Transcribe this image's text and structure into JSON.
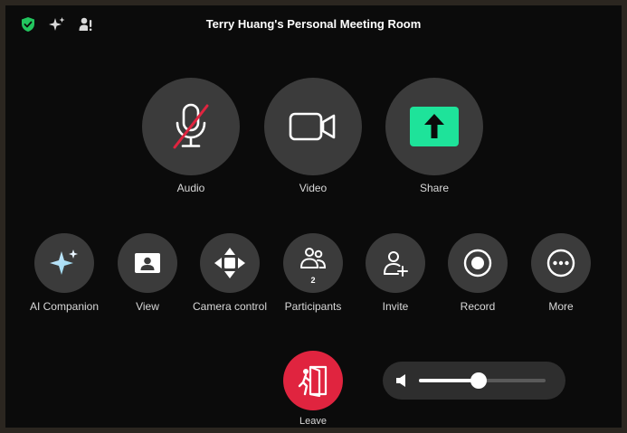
{
  "window": {
    "title": "Terry Huang's Personal Meeting Room"
  },
  "top_icons": [
    "shield-check-icon",
    "sparkle-icon",
    "person-info-icon"
  ],
  "main_controls": [
    {
      "label": "Audio",
      "icon": "microphone-muted-icon",
      "muted": true
    },
    {
      "label": "Video",
      "icon": "video-camera-icon"
    },
    {
      "label": "Share",
      "icon": "share-screen-icon"
    }
  ],
  "secondary_controls": [
    {
      "label": "AI Companion",
      "icon": "ai-sparkle-icon"
    },
    {
      "label": "View",
      "icon": "view-icon"
    },
    {
      "label": "Camera control",
      "icon": "camera-control-icon"
    },
    {
      "label": "Participants",
      "icon": "participants-icon",
      "count": "2"
    },
    {
      "label": "Invite",
      "icon": "invite-icon"
    },
    {
      "label": "Record",
      "icon": "record-icon"
    },
    {
      "label": "More",
      "icon": "more-icon"
    }
  ],
  "leave": {
    "label": "Leave",
    "icon": "exit-door-icon"
  },
  "volume": {
    "icon": "speaker-icon",
    "level": 0.47
  },
  "colors": {
    "background": "#0b0b0b",
    "button": "#3b3b3b",
    "share_accent": "#1ee39a",
    "leave_red": "#e0243f",
    "muted_red": "#e0243f",
    "shield_green": "#22c55e"
  }
}
